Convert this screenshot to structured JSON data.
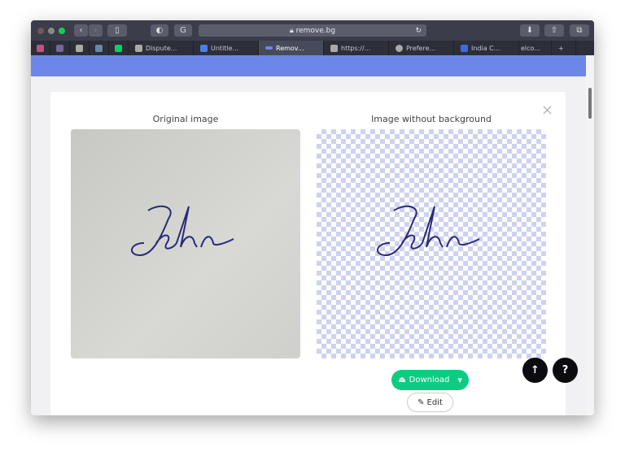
{
  "browser": {
    "url": "remove.bg",
    "pinned_tabs": [
      "pin-1",
      "pin-2",
      "pin-3",
      "pin-4",
      "pin-5"
    ],
    "tabs": [
      {
        "label": "Dispute..."
      },
      {
        "label": "Untitle..."
      },
      {
        "label": "Remov...",
        "active": true
      },
      {
        "label": "https://..."
      },
      {
        "label": "Prefere..."
      },
      {
        "label": "India C..."
      },
      {
        "label": "elco..."
      }
    ]
  },
  "modal": {
    "original_caption": "Original image",
    "result_caption": "Image without background",
    "signature_text": "John",
    "download_label": "Download",
    "edit_label": "Edit",
    "close_label": "×"
  },
  "floating": {
    "scroll_top": "↑",
    "help": "?"
  },
  "colors": {
    "accent": "#6c87e9",
    "download": "#0ccc83",
    "ink": "#2a2a7a"
  }
}
